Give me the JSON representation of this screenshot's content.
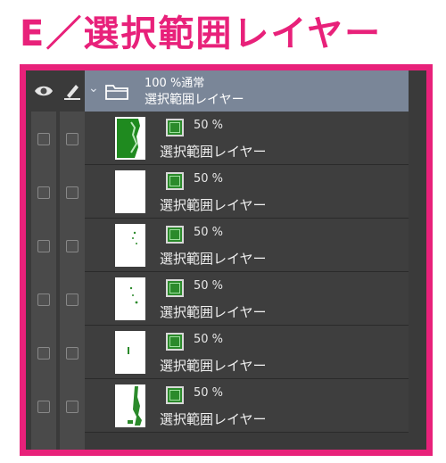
{
  "heading": "E／選択範囲レイヤー",
  "folder": {
    "blend": "100 %通常",
    "name": "選択範囲レイヤー"
  },
  "layers": [
    {
      "opacity": "50 %",
      "name": "選択範囲レイヤー"
    },
    {
      "opacity": "50 %",
      "name": "選択範囲レイヤー"
    },
    {
      "opacity": "50 %",
      "name": "選択範囲レイヤー"
    },
    {
      "opacity": "50 %",
      "name": "選択範囲レイヤー"
    },
    {
      "opacity": "50 %",
      "name": "選択範囲レイヤー"
    },
    {
      "opacity": "50 %",
      "name": "選択範囲レイヤー"
    }
  ],
  "colors": {
    "accent": "#e8217a",
    "folder_bg": "#7a8698",
    "selection_green": "#2b8a2b"
  }
}
